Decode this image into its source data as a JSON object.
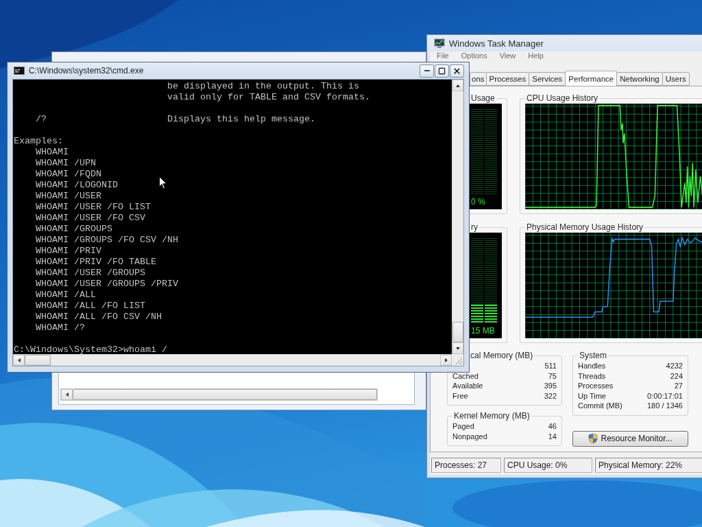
{
  "console_window": {
    "title": "C:\\Windows\\system32\\cmd.exe",
    "blocks": [
      [
        "                            be displayed in the output. This is",
        "                            valid only for TABLE and CSV formats."
      ],
      [
        "    /?                      Displays this help message."
      ],
      [
        "Examples:",
        "    WHOAMI",
        "    WHOAMI /UPN",
        "    WHOAMI /FQDN",
        "    WHOAMI /LOGONID",
        "    WHOAMI /USER",
        "    WHOAMI /USER /FO LIST",
        "    WHOAMI /USER /FO CSV",
        "    WHOAMI /GROUPS",
        "    WHOAMI /GROUPS /FO CSV /NH",
        "    WHOAMI /PRIV",
        "    WHOAMI /PRIV /FO TABLE",
        "    WHOAMI /USER /GROUPS",
        "    WHOAMI /USER /GROUPS /PRIV",
        "    WHOAMI /ALL",
        "    WHOAMI /ALL /FO LIST",
        "    WHOAMI /ALL /FO CSV /NH",
        "    WHOAMI /?"
      ],
      [
        "C:\\Windows\\System32>whoami /"
      ]
    ]
  },
  "task_manager": {
    "title": "Windows Task Manager",
    "menu": [
      "File",
      "Options",
      "View",
      "Help"
    ],
    "tabs": [
      {
        "label": "ons",
        "selected": false
      },
      {
        "label": "Processes",
        "selected": false
      },
      {
        "label": "Services",
        "selected": false
      },
      {
        "label": "Performance",
        "selected": true
      },
      {
        "label": "Networking",
        "selected": false
      },
      {
        "label": "Users",
        "selected": false
      }
    ],
    "cpu_meter": {
      "caption": "Usage",
      "reading": "0 %"
    },
    "cpu_history": {
      "caption": "CPU Usage History"
    },
    "memory_meter": {
      "caption": "ry",
      "reading": "15 MB",
      "level": 0.22
    },
    "memory_history": {
      "caption": "Physical Memory Usage History"
    },
    "physical_memory": {
      "caption": "cal Memory (MB)",
      "rows": [
        {
          "value": "511"
        },
        {
          "label": "Cached",
          "value": "75"
        },
        {
          "label": "Available",
          "value": "395"
        },
        {
          "label": "Free",
          "value": "322"
        }
      ]
    },
    "kernel_memory": {
      "caption": "Kernel Memory (MB)",
      "rows": [
        {
          "label": "Paged",
          "value": "46"
        },
        {
          "label": "Nonpaged",
          "value": "14"
        }
      ]
    },
    "system": {
      "caption": "System",
      "rows": [
        {
          "label": "Handles",
          "value": "4232"
        },
        {
          "label": "Threads",
          "value": "224"
        },
        {
          "label": "Processes",
          "value": "27"
        },
        {
          "label": "Up Time",
          "value": "0:00:17:01"
        },
        {
          "label": "Commit (MB)",
          "value": "180 / 1346"
        }
      ]
    },
    "resource_monitor_button": {
      "label": "Resource Monitor..."
    },
    "status_bar": [
      "Processes: 27",
      "CPU Usage: 0%",
      "Physical Memory: 22%"
    ]
  }
}
